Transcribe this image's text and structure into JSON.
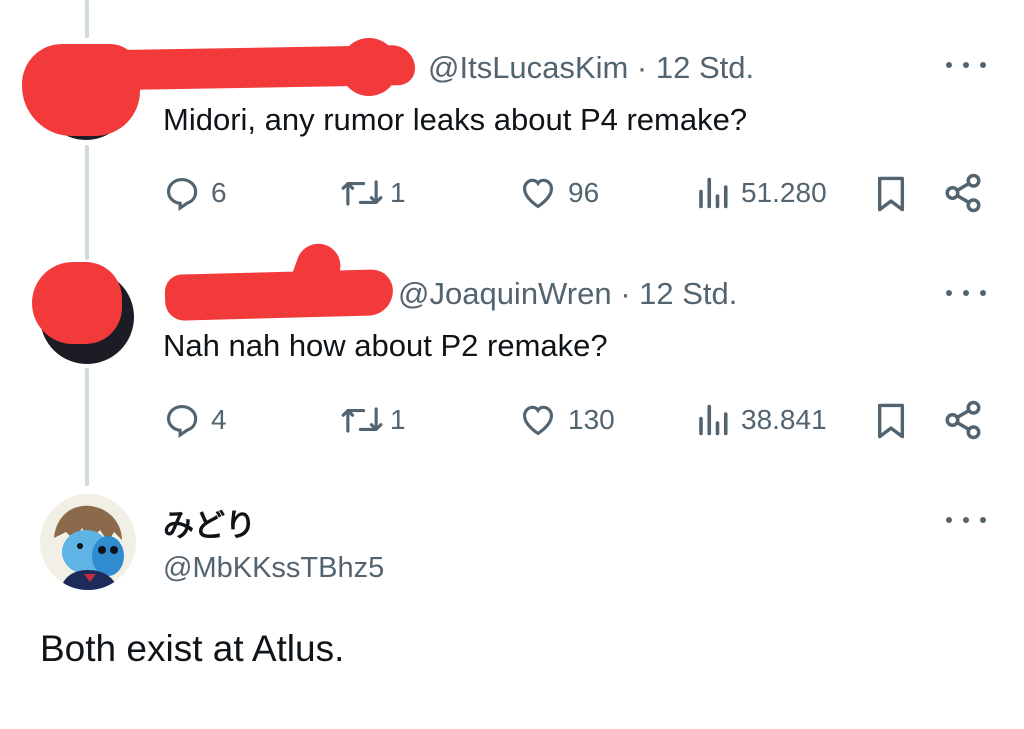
{
  "tweets": [
    {
      "handle": "@ItsLucasKim",
      "time": "12 Std.",
      "text": "Midori, any rumor leaks about P4 remake?",
      "replies": "6",
      "retweets": "1",
      "likes": "96",
      "views": "51.280"
    },
    {
      "handle": "@JoaquinWren",
      "time": "12 Std.",
      "text": "Nah nah how about P2 remake?",
      "replies": "4",
      "retweets": "1",
      "likes": "130",
      "views": "38.841"
    }
  ],
  "main_tweet": {
    "display_name": "みどり",
    "handle": "@MbKKssTBhz5",
    "text": "Both exist at Atlus."
  },
  "separator": " · ",
  "icons": {
    "reply": "reply-icon",
    "retweet": "retweet-icon",
    "like": "heart-icon",
    "views": "views-icon",
    "bookmark": "bookmark-icon",
    "share": "share-icon",
    "more": "more-icon"
  },
  "colors": {
    "text": "#0f1419",
    "secondary": "#536471",
    "thread_line": "#cfd9de",
    "redaction": "#f23a3a"
  }
}
